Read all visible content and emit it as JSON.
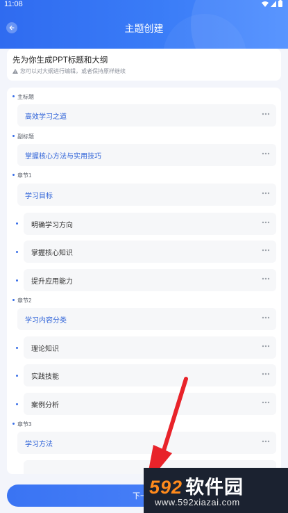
{
  "status_bar": {
    "time": "11:08"
  },
  "header": {
    "title": "主题创建"
  },
  "notice": {
    "title": "先为你生成PPT标题和大纲",
    "subtitle": "您可以对大纲进行编辑，或者保持原样继续"
  },
  "outline": {
    "main_title_label": "主标题",
    "main_title": "高效学习之道",
    "subtitle_label": "副标题",
    "subtitle": "掌握核心方法与实用技巧",
    "chapters": [
      {
        "label": "章节1",
        "title": "学习目标",
        "items": [
          "明确学习方向",
          "掌握核心知识",
          "提升应用能力"
        ]
      },
      {
        "label": "章节2",
        "title": "学习内容分类",
        "items": [
          "理论知识",
          "实践技能",
          "案例分析"
        ]
      },
      {
        "label": "章节3",
        "title": "学习方法",
        "items": []
      }
    ]
  },
  "footer": {
    "next_button": "下一步"
  },
  "watermark": {
    "logo_num": "592",
    "logo_text": "软件园",
    "url": "www.592xiazai.com"
  },
  "colors": {
    "primary": "#3a74f3",
    "annotation_arrow": "#e8232a"
  }
}
